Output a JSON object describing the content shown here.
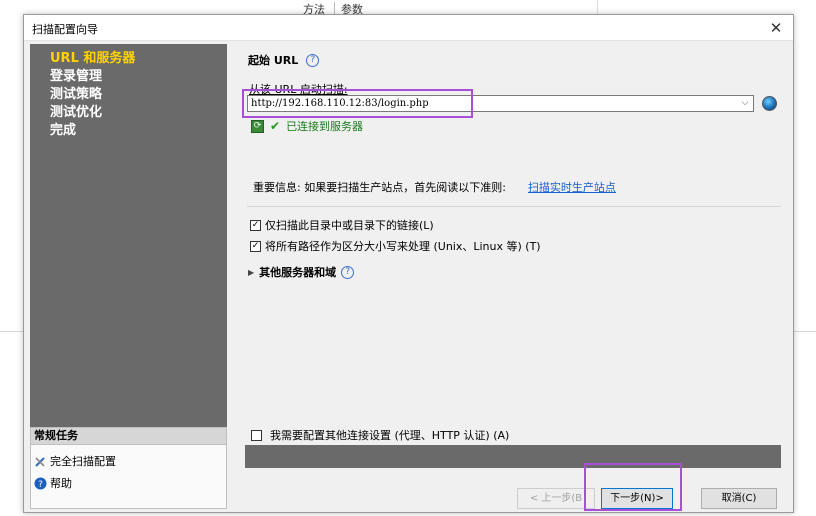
{
  "background": {
    "col1": "方法",
    "col2": "参数"
  },
  "dialog": {
    "title": "扫描配置向导",
    "close_glyph": "✕"
  },
  "nav": {
    "items": [
      {
        "label": "URL 和服务器",
        "active": true
      },
      {
        "label": "登录管理",
        "active": false
      },
      {
        "label": "测试策略",
        "active": false
      },
      {
        "label": "测试优化",
        "active": false
      },
      {
        "label": "完成",
        "active": false
      }
    ]
  },
  "tasks": {
    "header": "常规任务",
    "items": [
      {
        "label": "完全扫描配置",
        "icon": "wrench-icon"
      },
      {
        "label": "帮助",
        "icon": "help-icon"
      }
    ]
  },
  "main": {
    "heading": "起始 URL",
    "start_label": "从该 URL 启动扫描:",
    "url_value": "http://192.168.110.12:83/login.php",
    "dropdown_glyph": "⌵",
    "connected_text": "已连接到服务器",
    "info_text": "重要信息: 如果要扫描生产站点，首先阅读以下准则:",
    "info_link": "扫描实时生产站点",
    "cb_dir_only": "仅扫描此目录中或目录下的链接(L)",
    "cb_case": "将所有路径作为区分大小写来处理 (Unix、Linux 等) (T)",
    "other_servers": "其他服务器和域",
    "proxy_checkbox": "我需要配置其他连接设置 (代理、HTTP 认证) (A)"
  },
  "buttons": {
    "prev": "< 上一步(B",
    "next": "下一步(N)>",
    "cancel": "取消(C)"
  },
  "colors": {
    "nav_bg": "#6a6a6a",
    "nav_active": "#ffd200",
    "highlight": "#a74fd8",
    "link": "#1a5fd1",
    "success": "#1c7a1c"
  }
}
